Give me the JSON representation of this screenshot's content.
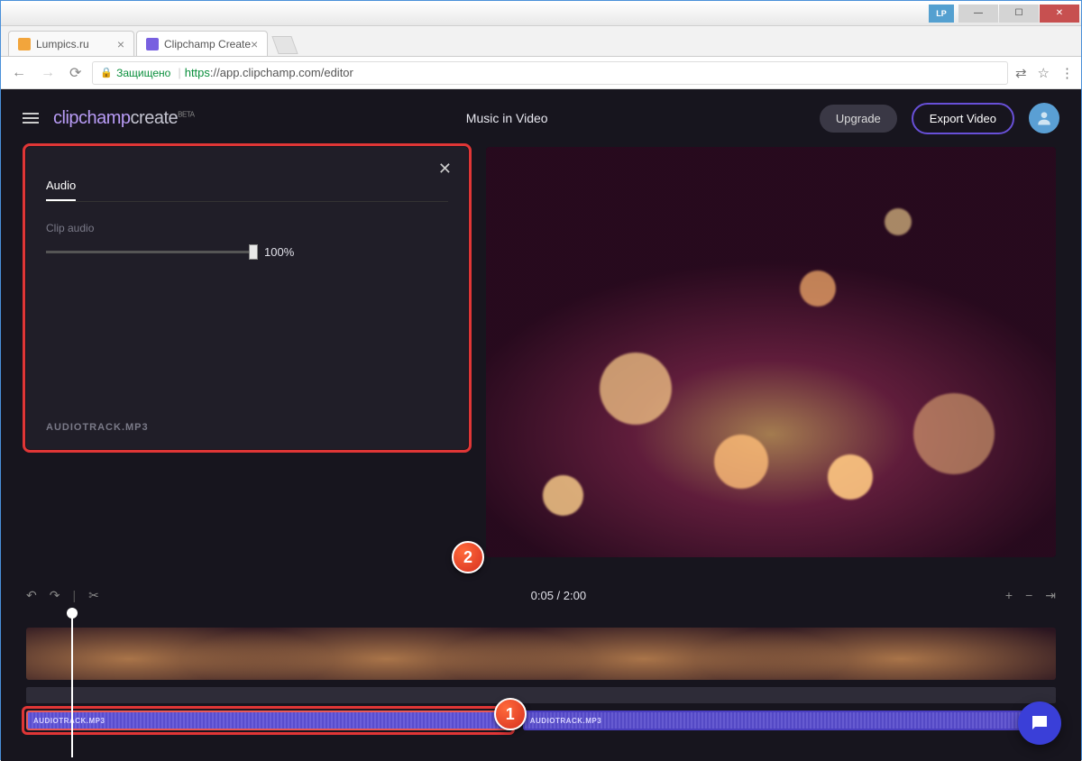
{
  "window": {
    "lp_badge": "LP"
  },
  "tabs": [
    {
      "label": "Lumpics.ru",
      "favicon": "#f2a53c",
      "active": false
    },
    {
      "label": "Clipchamp Create",
      "favicon": "#7860e0",
      "active": true
    }
  ],
  "urlbar": {
    "secure_label": "Защищено",
    "proto": "https",
    "url": "://app.clipchamp.com/editor"
  },
  "header": {
    "logo_brand": "clipchamp",
    "logo_suffix": "create",
    "logo_badge": "BETA",
    "project_title": "Music in Video",
    "upgrade": "Upgrade",
    "export": "Export Video"
  },
  "panel": {
    "tab_label": "Audio",
    "clip_audio_label": "Clip audio",
    "volume_value": "100%",
    "filename": "AUDIOTRACK.MP3"
  },
  "timeline": {
    "time": "0:05 / 2:00",
    "audio1_label": "AUDIOTRACK.MP3",
    "audio2_label": "AUDIOTRACK.MP3"
  },
  "callouts": {
    "one": "1",
    "two": "2"
  }
}
